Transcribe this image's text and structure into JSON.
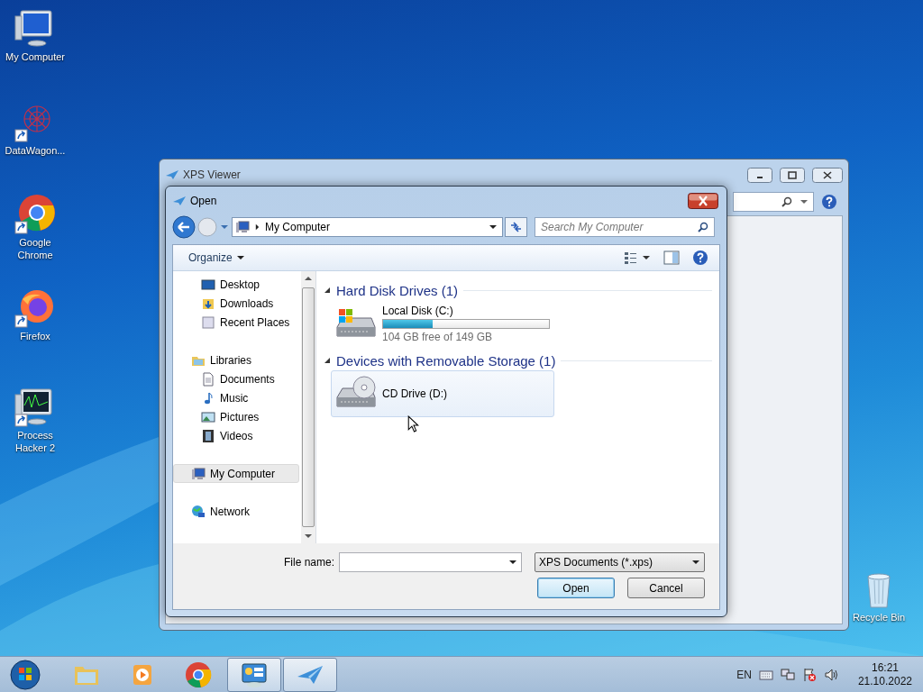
{
  "desktop_icons": [
    {
      "label": "My Computer",
      "kind": "computer",
      "shortcut": false
    },
    {
      "label": "DataWagon...",
      "kind": "datawagon",
      "shortcut": true
    },
    {
      "label": "Google Chrome",
      "kind": "chrome",
      "shortcut": true
    },
    {
      "label": "Firefox",
      "kind": "firefox",
      "shortcut": true
    },
    {
      "label": "Process Hacker 2",
      "kind": "monitor",
      "shortcut": true
    },
    {
      "label": "Recycle Bin",
      "kind": "bin",
      "shortcut": false
    }
  ],
  "background_window": {
    "title": "XPS Viewer"
  },
  "dialog": {
    "title": "Open",
    "address": "My Computer",
    "search": {
      "placeholder": "Search My Computer"
    },
    "organize": "Organize",
    "favorites": [
      {
        "label": "Desktop",
        "kind": "desktop",
        "selected": false
      },
      {
        "label": "Downloads",
        "kind": "downloads",
        "selected": false
      },
      {
        "label": "Recent Places",
        "kind": "recent",
        "selected": false
      }
    ],
    "nav_tree": [
      {
        "label": "Libraries",
        "kind": "libraries",
        "selected": false,
        "children": [
          {
            "label": "Documents",
            "kind": "documents",
            "selected": false
          },
          {
            "label": "Music",
            "kind": "music",
            "selected": false
          },
          {
            "label": "Pictures",
            "kind": "pictures",
            "selected": false
          },
          {
            "label": "Videos",
            "kind": "videos",
            "selected": false
          }
        ]
      },
      {
        "label": "My Computer",
        "kind": "computer",
        "selected": true
      },
      {
        "label": "Network",
        "kind": "network",
        "selected": false
      }
    ],
    "sections": [
      {
        "title": "Hard Disk Drives (1)",
        "expanded": true,
        "items": [
          {
            "name": "Local Disk (C:)",
            "kind": "disk",
            "level": 0.3,
            "free": "104 GB free of 149 GB",
            "highlighted": false
          }
        ]
      },
      {
        "title": "Devices with Removable Storage (1)",
        "expanded": true,
        "items": [
          {
            "name": "CD Drive (D:)",
            "kind": "cd",
            "highlighted": true
          }
        ]
      }
    ],
    "file_name_label": "File name:",
    "file_type": "XPS Documents (*.xps)",
    "buttons": [
      {
        "label": "Open",
        "default": true
      },
      {
        "label": "Cancel",
        "default": false
      }
    ]
  },
  "taskbar": {
    "apps": [
      {
        "kind": "explorer",
        "active": false
      },
      {
        "kind": "media",
        "active": false
      },
      {
        "kind": "chrome",
        "active": false
      },
      {
        "kind": "control",
        "active": true
      },
      {
        "kind": "xps",
        "active": true
      }
    ],
    "language": "EN",
    "time": "16:21",
    "date": "21.10.2022"
  }
}
